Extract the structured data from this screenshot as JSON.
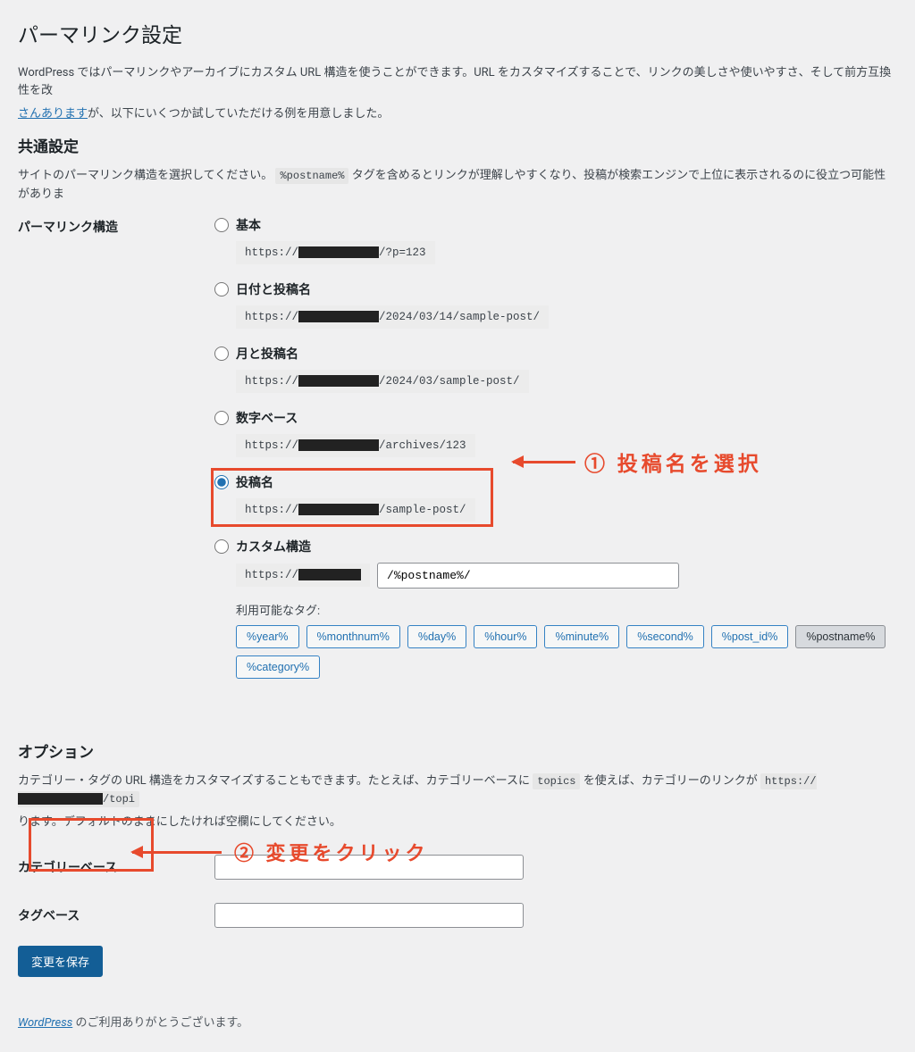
{
  "page_title": "パーマリンク設定",
  "intro_a": "WordPress ではパーマリンクやアーカイブにカスタム URL 構造を使うことができます。URL をカスタマイズすることで、リンクの美しさや使いやすさ、そして前方互換性を改",
  "intro_link": "さんあります",
  "intro_b": "が、以下にいくつか試していただける例を用意しました。",
  "section_common": "共通設定",
  "common_desc_a": "サイトのパーマリンク構造を選択してください。",
  "postname_tag": "%postname%",
  "common_desc_b": " タグを含めるとリンクが理解しやすくなり、投稿が検索エンジンで上位に表示されるのに役立つ可能性がありま",
  "structure_label": "パーマリンク構造",
  "options": {
    "plain": {
      "label": "基本",
      "prefix": "https://",
      "suffix": "/?p=123"
    },
    "date_name": {
      "label": "日付と投稿名",
      "prefix": "https://",
      "suffix": "/2024/03/14/sample-post/"
    },
    "month_name": {
      "label": "月と投稿名",
      "prefix": "https://",
      "suffix": "/2024/03/sample-post/"
    },
    "numeric": {
      "label": "数字ベース",
      "prefix": "https://",
      "suffix": "/archives/123"
    },
    "post_name": {
      "label": "投稿名",
      "prefix": "https://",
      "suffix": "/sample-post/"
    },
    "custom": {
      "label": "カスタム構造",
      "prefix": "https://",
      "value": "/%postname%/"
    }
  },
  "available_tags_label": "利用可能なタグ:",
  "tags": [
    "%year%",
    "%monthnum%",
    "%day%",
    "%hour%",
    "%minute%",
    "%second%",
    "%post_id%",
    "%postname%",
    "%category%"
  ],
  "active_tag_index": 7,
  "section_option": "オプション",
  "option_desc_a": "カテゴリー・タグの URL 構造をカスタマイズすることもできます。たとえば、カテゴリーベースに ",
  "option_topics": "topics",
  "option_desc_b": " を使えば、カテゴリーのリンクが ",
  "option_url_prefix": "https://",
  "option_url_suffix": "/topi",
  "option_desc_c": "ります。デフォルトのままにしたければ空欄にしてください。",
  "category_base_label": "カテゴリーベース",
  "tag_base_label": "タグベース",
  "submit_label": "変更を保存",
  "footer_link": "WordPress",
  "footer_text": " のご利用ありがとうございます。",
  "anno1": "① 投稿名を選択",
  "anno2": "② 変更をクリック"
}
